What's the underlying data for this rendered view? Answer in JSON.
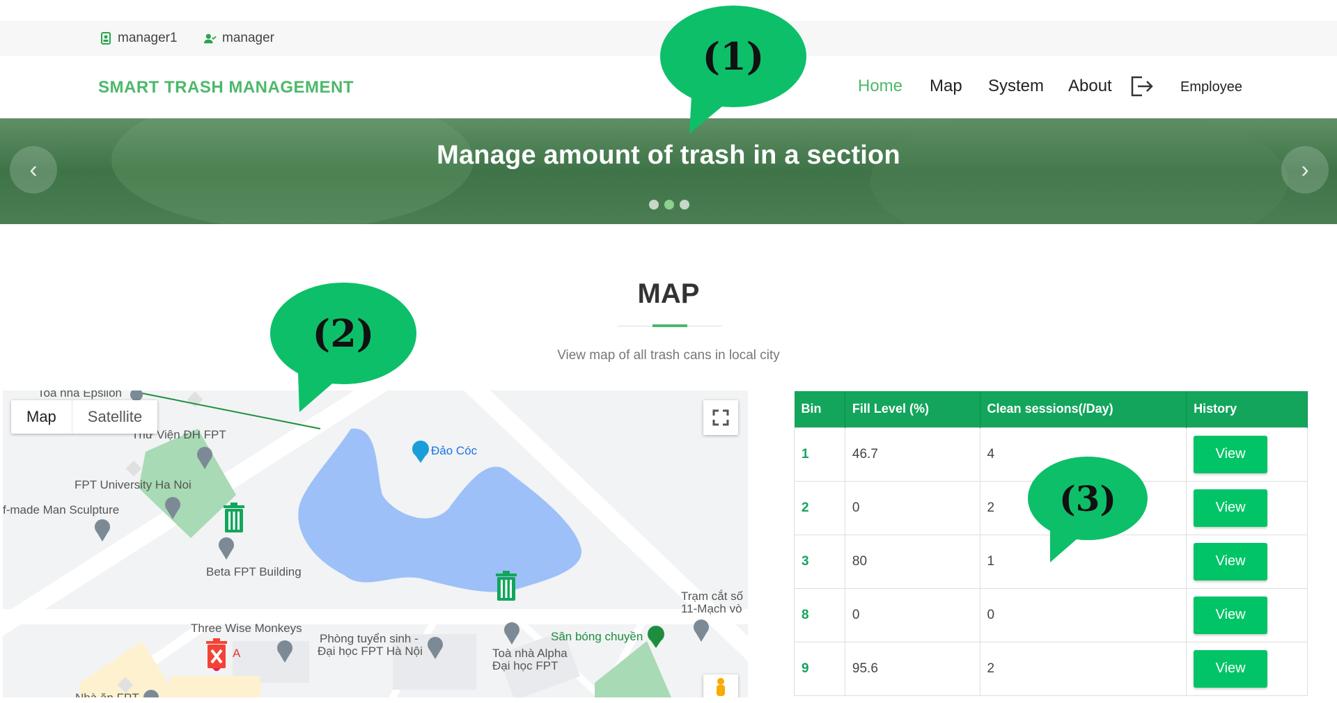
{
  "topbar": {
    "user": "manager1",
    "role": "manager"
  },
  "nav": {
    "brand": "SMART TRASH MANAGEMENT",
    "items": [
      {
        "label": "Home",
        "active": true
      },
      {
        "label": "Map"
      },
      {
        "label": "System"
      },
      {
        "label": "About"
      }
    ],
    "logout_icon": "logout-icon",
    "employee": "Employee"
  },
  "hero": {
    "title": "Manage amount of trash in a section",
    "slides": 3,
    "active_slide": 2
  },
  "section": {
    "title": "MAP",
    "subtitle": "View map of all trash cans in local city"
  },
  "map": {
    "type_buttons": [
      "Map",
      "Satellite"
    ],
    "labels": {
      "epsilon": "Toà nhà Epsilon",
      "library": "Thư Viện ĐH FPT",
      "fptu": "FPT University Ha Noi",
      "sculpture": "f-made Man Sculpture",
      "beta": "Beta FPT Building",
      "daococ": "Đảo Cóc",
      "monkeys": "Three Wise Monkeys",
      "admissions1": "Phòng tuyển sinh -",
      "admissions2": "Đại học FPT Hà Nội",
      "alpha1": "Toà nhà Alpha",
      "alpha2": "Đại học FPT",
      "court": "Sân bóng chuyền",
      "station1": "Trạm cắt số",
      "station2": "11-Mạch vò",
      "bottom1": "A",
      "bottom2": "Nhà ăn FPT"
    }
  },
  "table": {
    "headers": [
      "Bin",
      "Fill Level (%)",
      "Clean sessions(/Day)",
      "History"
    ],
    "rows": [
      {
        "bin": "1",
        "fill": "46.7",
        "sessions": "4",
        "action": "View"
      },
      {
        "bin": "2",
        "fill": "0",
        "sessions": "2",
        "action": "View"
      },
      {
        "bin": "3",
        "fill": "80",
        "sessions": "1",
        "action": "View"
      },
      {
        "bin": "8",
        "fill": "0",
        "sessions": "0",
        "action": "View"
      },
      {
        "bin": "9",
        "fill": "95.6",
        "sessions": "2",
        "action": "View"
      }
    ]
  },
  "callouts": [
    "(1)",
    "(2)",
    "(3)"
  ],
  "colors": {
    "brand": "#4cb86a",
    "table_header": "#13a55c",
    "button": "#00c466",
    "callout": "#0dbf69"
  }
}
